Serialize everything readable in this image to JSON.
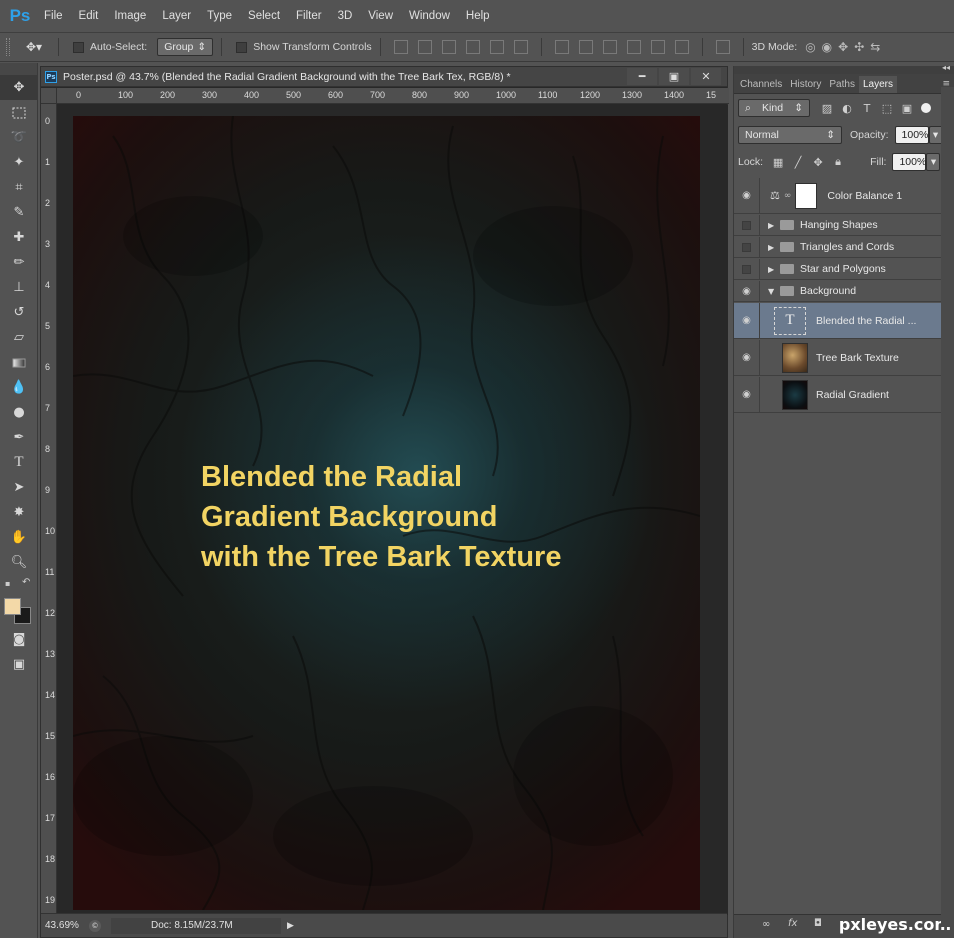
{
  "app": {
    "logo": "Ps"
  },
  "menu": [
    "File",
    "Edit",
    "Image",
    "Layer",
    "Type",
    "Select",
    "Filter",
    "3D",
    "View",
    "Window",
    "Help"
  ],
  "options": {
    "auto_select_label": "Auto-Select:",
    "auto_select_value": "Group",
    "transform_label": "Show Transform Controls",
    "mode_3d_label": "3D Mode:"
  },
  "document": {
    "title": "Poster.psd @ 43.7% (Blended the Radial  Gradient Background  with the Tree Bark Tex, RGB/8) *",
    "ruler_top": [
      "0",
      "100",
      "200",
      "300",
      "400",
      "500",
      "600",
      "700",
      "800",
      "900",
      "1000",
      "1100",
      "1200",
      "1300",
      "1400",
      "15"
    ],
    "ruler_left": [
      "0",
      "1",
      "2",
      "3",
      "4",
      "5",
      "6",
      "7",
      "8",
      "9",
      "10",
      "11",
      "12",
      "13",
      "14",
      "15",
      "16",
      "17",
      "18",
      "19"
    ],
    "poster_lines": [
      "Blended the Radial",
      "Gradient Background",
      "with the Tree Bark Texture"
    ],
    "zoom": "43.69%",
    "doc_size": "Doc: 8.15M/23.7M"
  },
  "panel": {
    "tabs": [
      "Channels",
      "History",
      "Paths",
      "Layers"
    ],
    "active_tab": "Layers",
    "filter_kind": "Kind",
    "blend_mode": "Normal",
    "opacity_label": "Opacity:",
    "opacity_value": "100%",
    "lock_label": "Lock:",
    "fill_label": "Fill:",
    "fill_value": "100%",
    "layers": [
      {
        "name": "Color Balance 1",
        "visible": true,
        "type": "adjustment"
      },
      {
        "name": "Hanging Shapes",
        "visible": false,
        "type": "group"
      },
      {
        "name": "Triangles and Cords",
        "visible": false,
        "type": "group"
      },
      {
        "name": "Star and Polygons",
        "visible": false,
        "type": "group"
      },
      {
        "name": "Background",
        "visible": true,
        "type": "group-open"
      },
      {
        "name": "Blended the Radial ...",
        "visible": true,
        "type": "text",
        "selected": true
      },
      {
        "name": "Tree Bark Texture",
        "visible": true,
        "type": "image"
      },
      {
        "name": "Radial Gradient",
        "visible": true,
        "type": "image"
      }
    ]
  },
  "watermark": "pxleyes.com",
  "colors": {
    "foreground": "#f3d9a8",
    "background": "#1a1a1a",
    "poster_text": "#f2d463"
  }
}
